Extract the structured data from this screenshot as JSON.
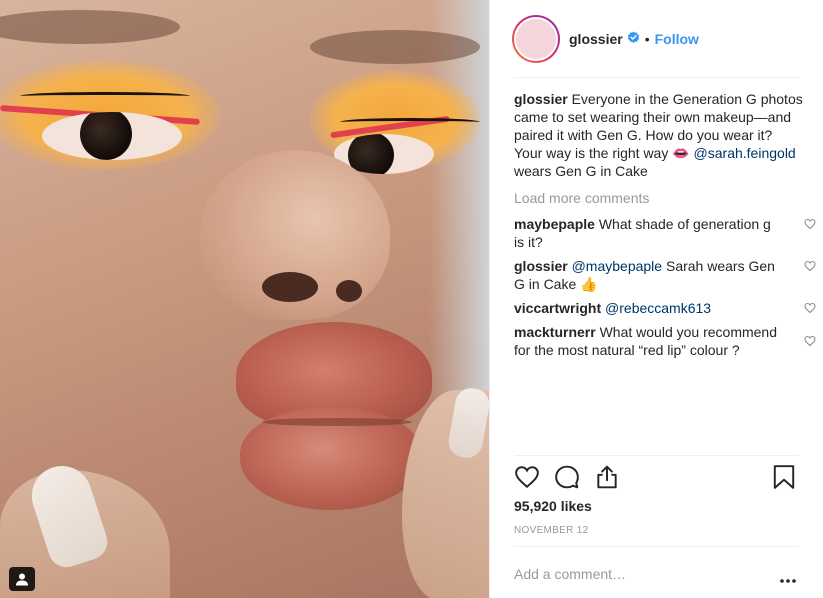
{
  "post": {
    "username": "glossier",
    "follow_label": "Follow",
    "dot": "•",
    "caption": {
      "user": "glossier",
      "text_before": "Everyone in the Generation G photos came to set wearing their own makeup—and paired it with Gen G. How do you wear it? Your way is the right way 👄",
      "mention": "@sarah.feingold",
      "text_after": "wears Gen G in Cake"
    },
    "load_more_label": "Load more comments",
    "comments": [
      {
        "user": "maybepaple",
        "mention": "",
        "text": "What shade of generation g is it?"
      },
      {
        "user": "glossier",
        "mention": "@maybepaple",
        "text": "Sarah wears Gen G in Cake 👍"
      },
      {
        "user": "viccartwright",
        "mention": "@rebeccamk613",
        "text": ""
      },
      {
        "user": "mackturnerr",
        "mention": "",
        "text": "What would you recommend for the most natural “red lip” colour ?"
      }
    ],
    "likes": "95,920 likes",
    "date": "NOVEMBER 12",
    "add_comment_placeholder": "Add a comment…",
    "more_label": "•••"
  },
  "icons": {
    "verified": "verified-badge-icon",
    "heart": "heart-icon",
    "comment": "comment-bubble-icon",
    "share": "share-icon",
    "save": "bookmark-icon",
    "tag": "user-tag-icon",
    "more": "more-options-icon"
  },
  "colors": {
    "link_blue": "#3897f0",
    "mention_blue": "#003569",
    "muted": "#999999",
    "text": "#262626",
    "border": "#efefef"
  }
}
